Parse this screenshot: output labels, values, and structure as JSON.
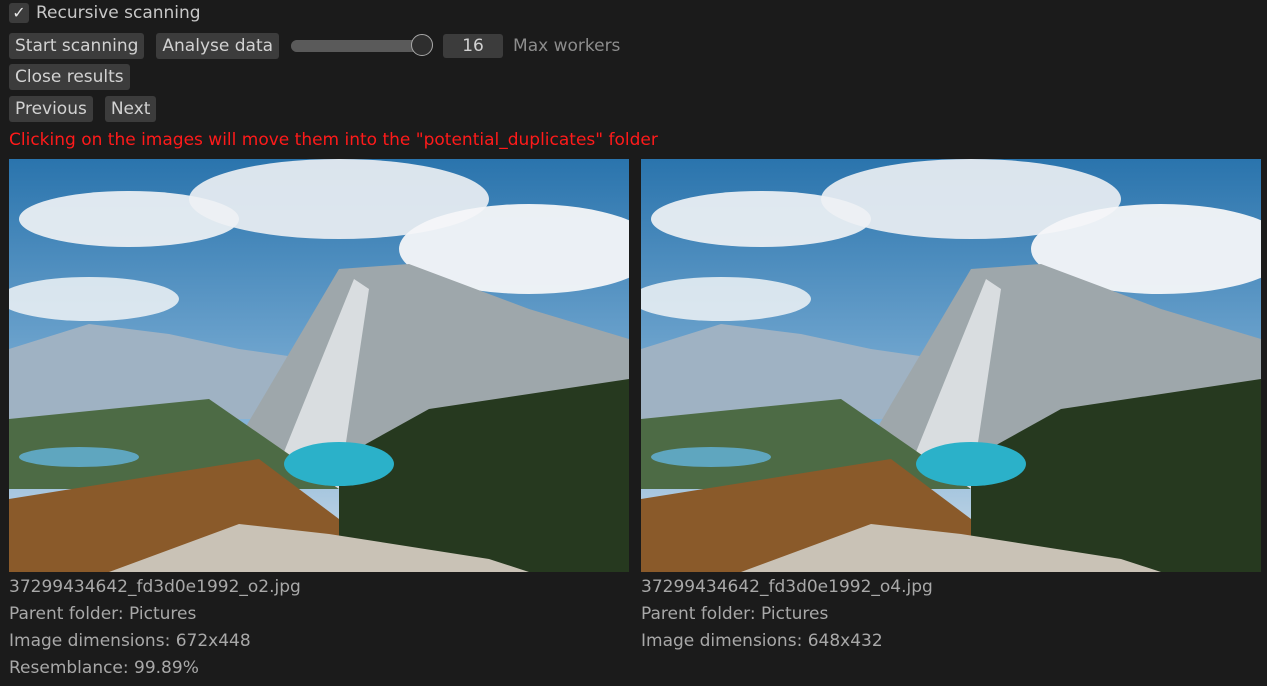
{
  "controls": {
    "recursive_label": "Recursive scanning",
    "recursive_checked": true,
    "start_label": "Start scanning",
    "analyse_label": "Analyse data",
    "workers_value": "16",
    "workers_label": "Max workers",
    "workers_level": 1.0,
    "close_label": "Close results",
    "previous_label": "Previous",
    "next_label": "Next"
  },
  "notice": "Clicking on the images will move them into the \"potential_duplicates\" folder",
  "left": {
    "filename": "37299434642_fd3d0e1992_o2.jpg",
    "parent": "Parent folder: Pictures",
    "dimensions": "Image dimensions: 672x448",
    "resemblance": "Resemblance: 99.89%"
  },
  "right": {
    "filename": "37299434642_fd3d0e1992_o4.jpg",
    "parent": "Parent folder: Pictures",
    "dimensions": "Image dimensions: 648x432"
  },
  "colors": {
    "background": "#1b1b1b",
    "button": "#3c3c3c",
    "warning": "#ff1a1a"
  }
}
